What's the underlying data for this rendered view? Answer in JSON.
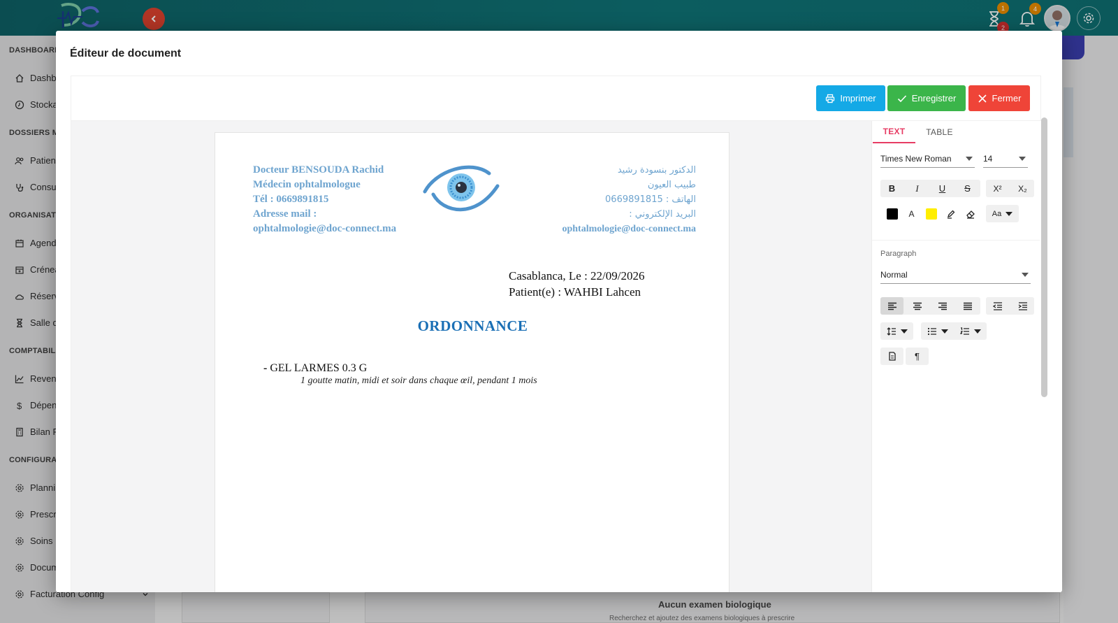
{
  "topbar": {
    "hourglass_badge_1": "1",
    "hourglass_badge_2": "2",
    "bell_badge": "4",
    "colors": {
      "bar": "#0e6d70",
      "collapse": "#d9412e",
      "badge_orange": "#e68a00",
      "badge_red": "#d32f2f"
    }
  },
  "sidebar": {
    "sections": [
      "DASHBOARDS",
      "DOSSIERS ME",
      "ORGANISATI",
      "COMPTABILIT",
      "CONFIGURAT"
    ],
    "items": [
      "Dashb",
      "Stocka",
      "Patien",
      "Consul",
      "Agenda",
      "Crénea",
      "Réserv",
      "Salle d'a",
      "Revenu",
      "Dépens",
      "Bilan Fi",
      "Planni",
      "Prescr",
      "Soins",
      "Docum",
      "Facturation Config"
    ]
  },
  "background": {
    "empty_title": "Aucun examen biologique",
    "empty_sub": "Recherchez et ajoutez des examens biologiques à prescrire"
  },
  "modal": {
    "title": "Éditeur de document",
    "buttons": {
      "print": "Imprimer",
      "save": "Enregistrer",
      "close": "Fermer"
    }
  },
  "document": {
    "header_left": [
      "Docteur BENSOUDA Rachid",
      "Médecin ophtalmologue",
      "Tél : 0669891815",
      "Adresse mail :",
      "ophtalmologie@doc-connect.ma"
    ],
    "header_right": [
      "الدكتور بنسودة رشيد",
      "طبيب العيون",
      "الهاتف : 0669891815",
      "البريد الإلكتروني :",
      "ophtalmologie@doc-connect.ma"
    ],
    "place_date": "Casablanca, Le : 22/09/2026",
    "patient": "Patient(e) :  WAHBI Lahcen",
    "title": "ORDONNANCE",
    "medication_dash": "-",
    "medication": "GEL LARMES 0.3 G",
    "instruction": "1 goutte matin, midi et soir dans chaque œil, pendant 1 mois"
  },
  "panel": {
    "tabs": [
      "TEXT",
      "TABLE"
    ],
    "font_family": "Times New Roman",
    "font_size": "14",
    "format_buttons": [
      "B",
      "I",
      "U",
      "S",
      "X²",
      "X₂"
    ],
    "text_color_label": "A",
    "case_label": "Aa",
    "paragraph_label": "Paragraph",
    "paragraph_style": "Normal",
    "pilcrow": "¶",
    "colors": {
      "text_color": "#000000",
      "highlight": "#ffee00",
      "tab_accent": "#e73c64"
    }
  }
}
